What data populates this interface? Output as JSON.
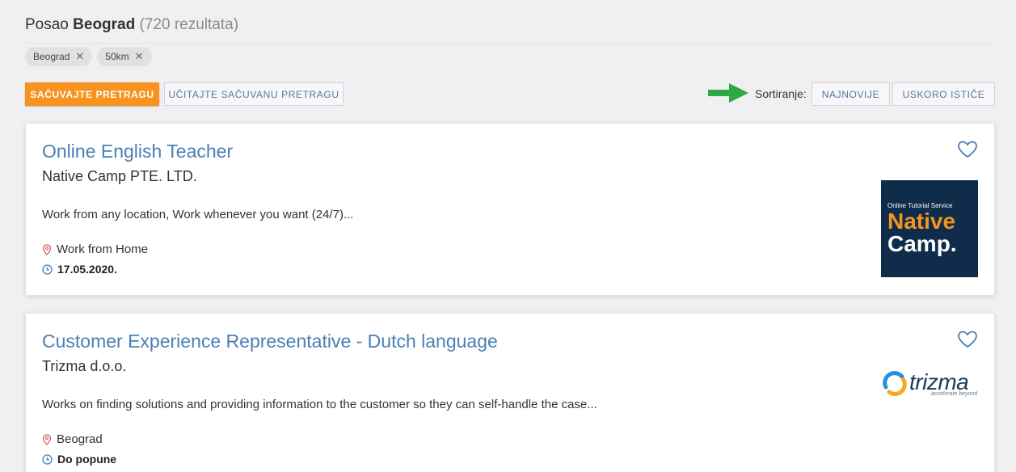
{
  "header": {
    "prefix": "Posao",
    "city": "Beograd",
    "count": "(720 rezultata)"
  },
  "filters": [
    {
      "label": "Beograd"
    },
    {
      "label": "50km"
    }
  ],
  "actions": {
    "save_search": "SAČUVAJTE PRETRAGU",
    "load_search": "UČITAJTE SAČUVANU PRETRAGU"
  },
  "sort": {
    "label": "Sortiranje:",
    "newest": "NAJNOVIJE",
    "expiring": "USKORO ISTIČE"
  },
  "colors": {
    "accent_orange": "#f7931e",
    "link_blue": "#4a7fb5",
    "arrow_green": "#2ea844",
    "location_red": "#e05a5a"
  },
  "jobs": [
    {
      "title": "Online English Teacher",
      "company": "Native Camp PTE. LTD.",
      "description": "Work from any location, Work whenever you want (24/7)...",
      "location": "Work from Home",
      "date": "17.05.2020.",
      "logo": {
        "tagline": "Online Tutorial Service",
        "line1": "Native",
        "line2": "Camp."
      }
    },
    {
      "title": "Customer Experience Representative - Dutch language",
      "company": "Trizma d.o.o.",
      "description": "Works on finding solutions and providing information to the customer so they can self-handle the case...",
      "location": "Beograd",
      "date": "Do popune",
      "logo": {
        "word": "trizma",
        "sub": "accelerate beyond"
      }
    }
  ]
}
